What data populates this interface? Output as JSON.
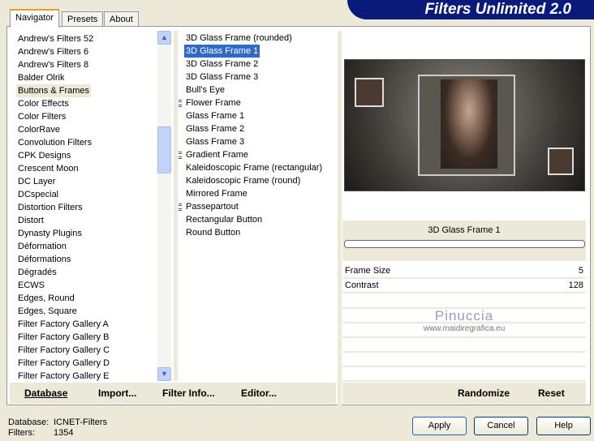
{
  "title": "Filters Unlimited 2.0",
  "tabs": [
    "Navigator",
    "Presets",
    "About"
  ],
  "categories": [
    "Andrew's Filters 52",
    "Andrew's Filters 6",
    "Andrew's Filters 8",
    "Balder Olrik",
    "Buttons & Frames",
    "Color Effects",
    "Color Filters",
    "ColorRave",
    "Convolution Filters",
    "CPK Designs",
    "Crescent Moon",
    "DC Layer",
    "DCspecial",
    "Distortion Filters",
    "Distort",
    "Dynasty Plugins",
    "Déformation",
    "Déformations",
    "Dégradés",
    "ECWS",
    "Edges, Round",
    "Edges, Square",
    "Filter Factory Gallery A",
    "Filter Factory Gallery B",
    "Filter Factory Gallery C",
    "Filter Factory Gallery D",
    "Filter Factory Gallery E"
  ],
  "selected_category": "Buttons & Frames",
  "filters": [
    {
      "label": "3D Glass Frame (rounded)",
      "group": false
    },
    {
      "label": "3D Glass Frame 1",
      "group": false,
      "selected": true
    },
    {
      "label": "3D Glass Frame 2",
      "group": false
    },
    {
      "label": "3D Glass Frame 3",
      "group": false
    },
    {
      "label": "Bull's Eye",
      "group": false
    },
    {
      "label": "Flower Frame",
      "group": true
    },
    {
      "label": "Glass Frame 1",
      "group": false
    },
    {
      "label": "Glass Frame 2",
      "group": false
    },
    {
      "label": "Glass Frame 3",
      "group": false
    },
    {
      "label": "Gradient Frame",
      "group": true
    },
    {
      "label": "Kaleidoscopic Frame (rectangular)",
      "group": false
    },
    {
      "label": "Kaleidoscopic Frame (round)",
      "group": false
    },
    {
      "label": "Mirrored Frame",
      "group": false
    },
    {
      "label": "Passepartout",
      "group": true
    },
    {
      "label": "Rectangular Button",
      "group": false
    },
    {
      "label": "Round Button",
      "group": false
    }
  ],
  "preview": {
    "filter_name": "3D Glass Frame 1",
    "progress": 0
  },
  "params": [
    {
      "label": "Frame Size",
      "value": "5"
    },
    {
      "label": "Contrast",
      "value": "128"
    }
  ],
  "watermark": {
    "name": "Pinuccia",
    "url": "www.maidiregrafica.eu"
  },
  "left_buttons": [
    "Database",
    "Import...",
    "Filter Info...",
    "Editor..."
  ],
  "right_buttons": [
    "Randomize",
    "Reset"
  ],
  "status": {
    "database_label": "Database:",
    "database_value": "ICNET-Filters",
    "filters_label": "Filters:",
    "filters_value": "1354"
  },
  "dialog_buttons": {
    "apply": "Apply",
    "cancel": "Cancel",
    "help": "Help"
  }
}
